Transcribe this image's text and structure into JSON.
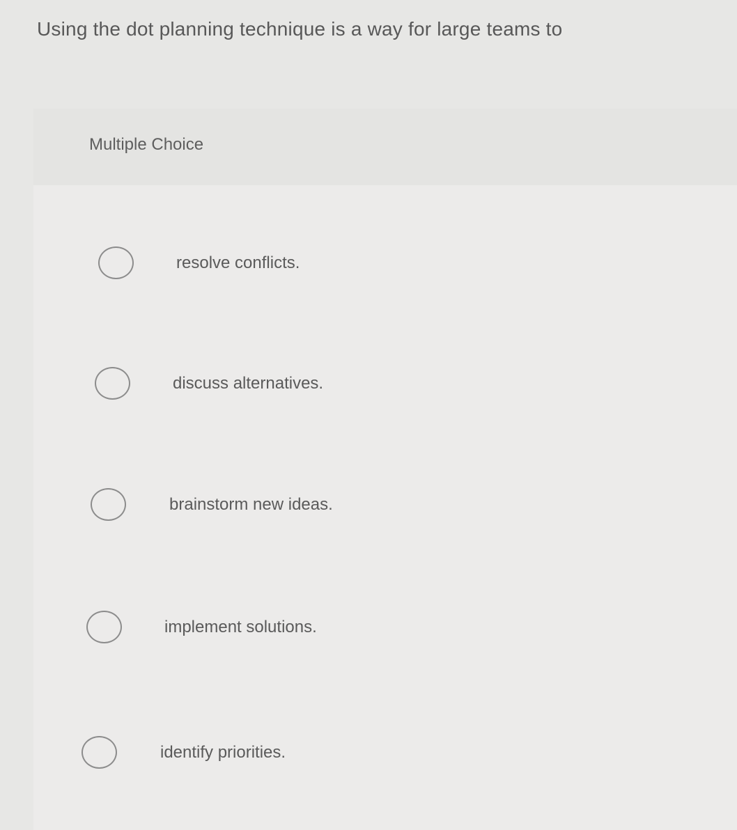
{
  "question": {
    "text": "Using the dot planning technique is a way for large teams to"
  },
  "card": {
    "type_label": "Multiple Choice"
  },
  "options": [
    {
      "label": "resolve conflicts.",
      "selected": false
    },
    {
      "label": "discuss alternatives.",
      "selected": false
    },
    {
      "label": "brainstorm new ideas.",
      "selected": false
    },
    {
      "label": "implement solutions.",
      "selected": false
    },
    {
      "label": "identify priorities.",
      "selected": false
    }
  ]
}
